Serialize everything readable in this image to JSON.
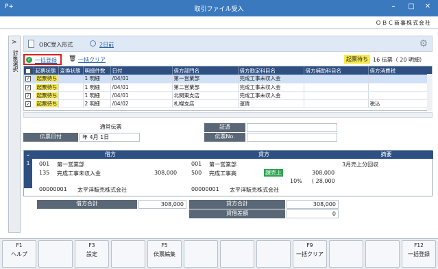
{
  "window": {
    "title": "取引ファイル受入",
    "app_icon": "P+"
  },
  "company": "ＯＢＣ商事株式会社",
  "side_tab_label": "対象選択",
  "format": {
    "label": "OBC受入形式",
    "days_ago": "2日前"
  },
  "actions": {
    "bulk_register": "一括登録",
    "bulk_clear": "一括クリア"
  },
  "summary": {
    "badge": "起票待ち",
    "count": "16 伝票（ 20 明細）"
  },
  "grid": {
    "columns": [
      "",
      "起票状態",
      "変換状態",
      "明細件数",
      "日付",
      "借方部門名",
      "借方勘定科目名",
      "借方補助科目名",
      "借方消費税"
    ],
    "rows": [
      {
        "checked": true,
        "status": "起票待ち",
        "count": "1 明細",
        "date": "/04/01",
        "dept": "第一営業部",
        "account": "完成工事未収入金",
        "sub": "",
        "tax": ""
      },
      {
        "checked": true,
        "status": "起票待ち",
        "count": "1 明細",
        "date": "/04/01",
        "dept": "第二営業部",
        "account": "完成工事未収入金",
        "sub": "",
        "tax": ""
      },
      {
        "checked": true,
        "status": "起票待ち",
        "count": "1 明細",
        "date": "/04/01",
        "dept": "北関東支店",
        "account": "完成工事未収入金",
        "sub": "",
        "tax": ""
      },
      {
        "checked": true,
        "status": "起票待ち",
        "count": "2 明細",
        "date": "/04/02",
        "dept": "札幌支店",
        "account": "運賃",
        "sub": "",
        "tax": "税込"
      }
    ]
  },
  "header": {
    "type": "通常伝票",
    "date_label": "伝票日付",
    "date_value": "年  4月  1日",
    "cert_label": "証憑",
    "no_label": "伝票No."
  },
  "journal": {
    "debit_header": "借方",
    "credit_header": "貸方",
    "memo_header": "摘要",
    "row_num": "1",
    "debit": {
      "dept_code": "001",
      "dept_name": "第一営業部",
      "acct_code": "135",
      "acct_name": "完成工事未収入金",
      "amount": "308,000",
      "partner_code": "00000001",
      "partner_name": "太平洋販売株式会社"
    },
    "credit": {
      "dept_code": "001",
      "dept_name": "第一営業部",
      "acct_code": "500",
      "acct_name": "完成工事高",
      "tax_badge": "課売上",
      "amount": "308,000",
      "rate": "10%",
      "tax": "( 28,000",
      "partner_code": "00000001",
      "partner_name": "太平洋販売株式会社"
    },
    "memo": "3月売上分回収"
  },
  "totals": {
    "debit_label": "借方合計",
    "debit_value": "308,000",
    "credit_label": "貸方合計",
    "credit_value": "308,000",
    "diff_label": "貸借差額",
    "diff_value": "0"
  },
  "fkeys": [
    {
      "key": "F1",
      "label": "ヘルプ"
    },
    {
      "key": "",
      "label": ""
    },
    {
      "key": "F3",
      "label": "設定"
    },
    {
      "key": "",
      "label": ""
    },
    {
      "key": "F5",
      "label": "伝票編集"
    },
    {
      "key": "",
      "label": ""
    },
    {
      "key": "",
      "label": ""
    },
    {
      "key": "",
      "label": ""
    },
    {
      "key": "F9",
      "label": "一括クリア"
    },
    {
      "key": "",
      "label": ""
    },
    {
      "key": "",
      "label": ""
    },
    {
      "key": "F12",
      "label": "一括登録"
    }
  ]
}
